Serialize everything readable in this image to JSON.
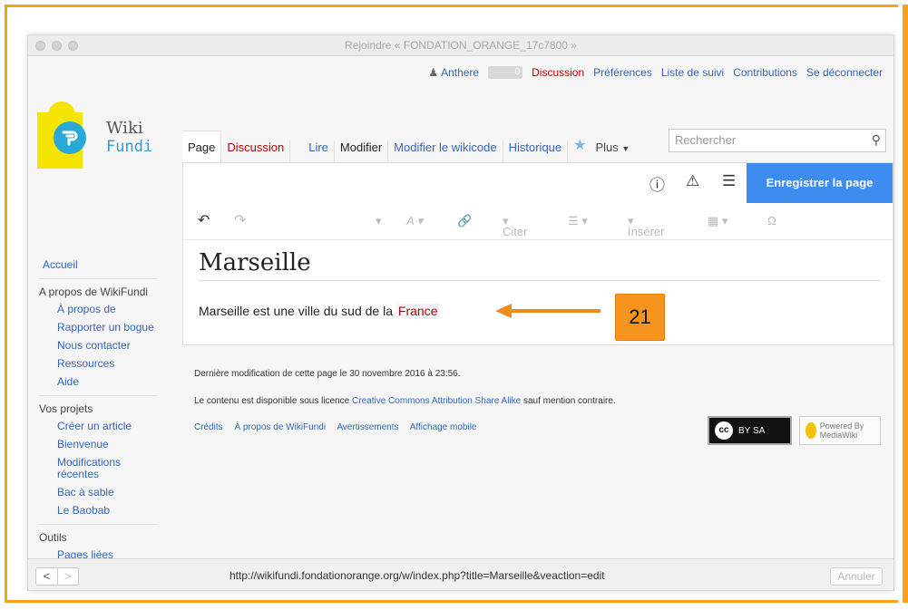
{
  "window": {
    "title": "Rejoindre « FONDATION_ORANGE_17c7800 »"
  },
  "personal": {
    "user": "Anthere",
    "notifications": "0",
    "discussion": "Discussion",
    "preferences": "Préférences",
    "watchlist": "Liste de suivi",
    "contributions": "Contributions",
    "logout": "Se déconnecter"
  },
  "logo": {
    "line1": "Wiki",
    "line2": "Fundi"
  },
  "tabs": {
    "page": "Page",
    "discussion": "Discussion",
    "read": "Lire",
    "edit": "Modifier",
    "edit_source": "Modifier le wikicode",
    "history": "Historique",
    "more": "Plus"
  },
  "search": {
    "placeholder": "Rechercher"
  },
  "toolbar": {
    "save": "Enregistrer la page",
    "cite": "Citer",
    "insert": "Insérer",
    "special_char": "Ω"
  },
  "article": {
    "title": "Marseille",
    "text_before": "Marseille est une ville du sud de la ",
    "link": "France"
  },
  "annotation": {
    "number": "21",
    "arrow_color": "#f28a1b"
  },
  "sidebar": {
    "home": "Accueil",
    "section_about": "A propos de WikiFundi",
    "about_items": [
      "À propos de",
      "Rapporter un bogue",
      "Nous contacter",
      "Ressources",
      "Aide"
    ],
    "section_projects": "Vos projets",
    "project_items": [
      "Créer un article",
      "Bienvenue",
      "Modifications récentes",
      "Bac à sable",
      "Le Baobab"
    ],
    "section_tools": "Outils",
    "tool_items": [
      "Pages liées"
    ]
  },
  "footer": {
    "last_modified": "Dernière modification de cette page le 30 novembre 2016 à 23:56.",
    "license_prefix": "Le contenu est disponible sous licence ",
    "license_link": "Creative Commons Attribution Share Alike",
    "license_suffix": " sauf mention contraire.",
    "links": [
      "Crédits",
      "À propos de WikiFundi",
      "Avertissements",
      "Affichage mobile"
    ],
    "cc_label": "BY SA",
    "mw_label": "Powered By MediaWiki"
  },
  "statusbar": {
    "url": "http://wikifundi.fondationorange.org/w/index.php?title=Marseille&veaction=edit",
    "cancel": "Annuler",
    "back": "<",
    "forward": ">"
  }
}
